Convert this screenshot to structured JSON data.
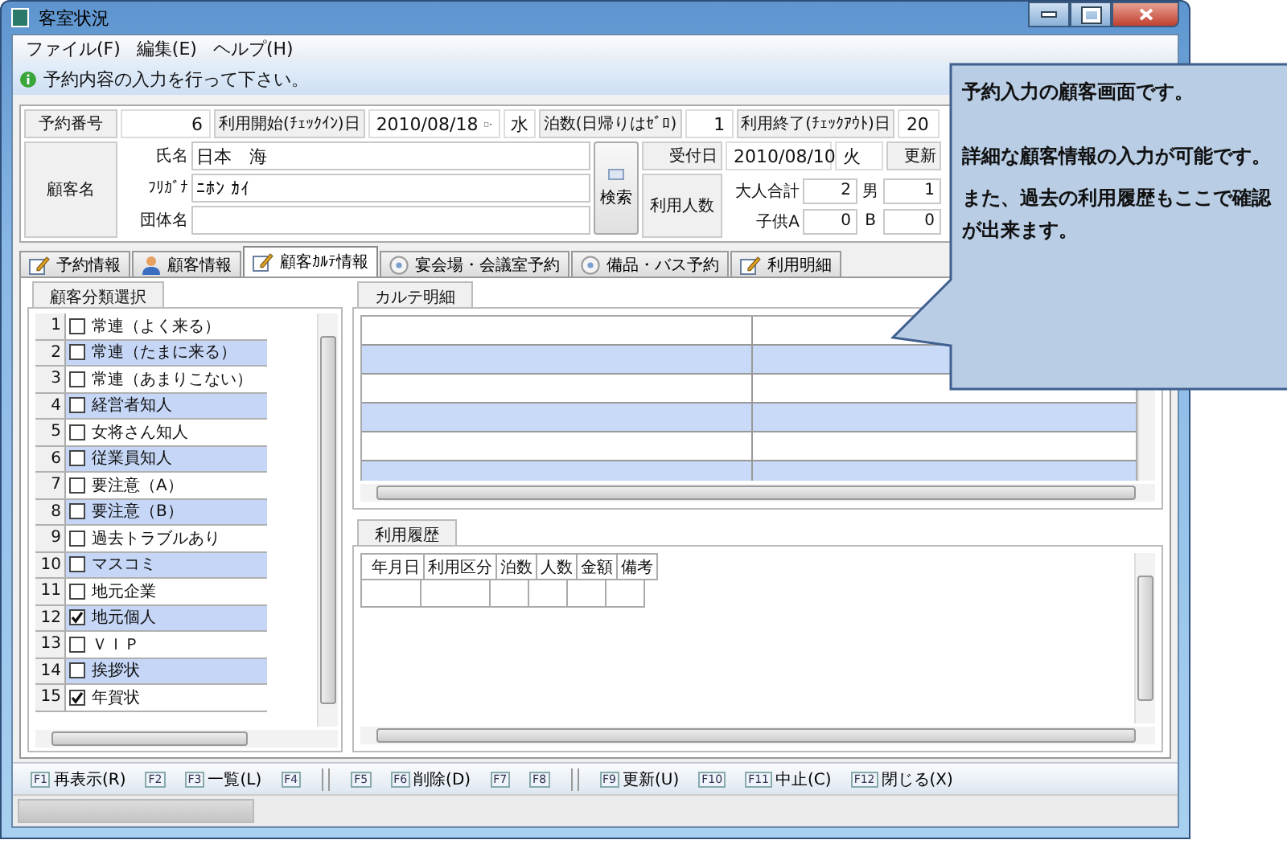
{
  "window": {
    "title": "客室状況"
  },
  "menu": [
    "ファイル(F)",
    "編集(E)",
    "ヘルプ(H)"
  ],
  "info_bar": {
    "message": "予約内容の入力を行って下さい。"
  },
  "header": {
    "reservation_no": {
      "label": "予約番号",
      "value": "6"
    },
    "checkin": {
      "label": "利用開始(ﾁｪｯｸｲﾝ)日",
      "value": "2010/08/18",
      "weekday": "水"
    },
    "nights": {
      "label": "泊数(日帰りはｾﾞﾛ)",
      "value": "1"
    },
    "checkout": {
      "label": "利用終了(ﾁｪｯｸｱｳﾄ)日",
      "value": "20"
    },
    "customer": {
      "label": "顧客名",
      "fields": [
        {
          "label": "氏名",
          "value": "日本　海"
        },
        {
          "label": "ﾌﾘｶﾞﾅ",
          "value": "ﾆﾎﾝ ｶｲ"
        },
        {
          "label": "団体名"
        }
      ],
      "search_button": "検索"
    },
    "received": {
      "label": "受付日",
      "value": "2010/08/10",
      "weekday": "火",
      "updated_label": "更新"
    },
    "guests": {
      "label": "利用人数",
      "rows": [
        {
          "label": "大人合計",
          "value": "2",
          "label2": "男",
          "value2": "1"
        },
        {
          "label": "子供A",
          "value": "0",
          "label2": "B",
          "value2": "0"
        }
      ]
    }
  },
  "tabs": [
    {
      "label": "予約情報",
      "kind": "note",
      "selected": false
    },
    {
      "label": "顧客情報",
      "kind": "person",
      "selected": false
    },
    {
      "label": "顧客ｶﾙﾃ情報",
      "kind": "note",
      "selected": true
    },
    {
      "label": "宴会場・会議室予約",
      "kind": "disc",
      "selected": false
    },
    {
      "label": "備品・バス予約",
      "kind": "disc",
      "selected": false
    },
    {
      "label": "利用明細",
      "kind": "note",
      "selected": false
    }
  ],
  "category_panel": {
    "title": "顧客分類選択",
    "items": [
      {
        "no": "1",
        "label": "常連（よく来る）",
        "checked": false
      },
      {
        "no": "2",
        "label": "常連（たまに来る）",
        "checked": false
      },
      {
        "no": "3",
        "label": "常連（あまりこない）",
        "checked": false
      },
      {
        "no": "4",
        "label": "経営者知人",
        "checked": false
      },
      {
        "no": "5",
        "label": "女将さん知人",
        "checked": false
      },
      {
        "no": "6",
        "label": "従業員知人",
        "checked": false
      },
      {
        "no": "7",
        "label": "要注意（A）",
        "checked": false
      },
      {
        "no": "8",
        "label": "要注意（B）",
        "checked": false
      },
      {
        "no": "9",
        "label": "過去トラブルあり",
        "checked": false
      },
      {
        "no": "10",
        "label": "マスコミ",
        "checked": false
      },
      {
        "no": "11",
        "label": "地元企業",
        "checked": false
      },
      {
        "no": "12",
        "label": "地元個人",
        "checked": true
      },
      {
        "no": "13",
        "label": "ＶＩＰ",
        "checked": false
      },
      {
        "no": "14",
        "label": "挨拶状",
        "checked": false
      },
      {
        "no": "15",
        "label": "年賀状",
        "checked": true
      }
    ]
  },
  "karte_panel": {
    "title": "カルテ明細"
  },
  "history_panel": {
    "title": "利用履歴",
    "columns": [
      "年月日",
      "利用区分",
      "泊数",
      "人数",
      "金額",
      "備考"
    ]
  },
  "function_keys": [
    [
      {
        "key": "F1",
        "label": "再表示(R)"
      },
      {
        "key": "F2"
      },
      {
        "key": "F3",
        "label": "一覧(L)"
      },
      {
        "key": "F4"
      }
    ],
    [
      {
        "key": "F5"
      },
      {
        "key": "F6",
        "label": "削除(D)"
      },
      {
        "key": "F7"
      },
      {
        "key": "F8"
      }
    ],
    [
      {
        "key": "F9",
        "label": "更新(U)"
      },
      {
        "key": "F10"
      },
      {
        "key": "F11",
        "label": "中止(C)"
      },
      {
        "key": "F12",
        "label": "閉じる(X)"
      }
    ]
  ],
  "callout": {
    "paragraphs": [
      "予約入力の顧客画面です。",
      "詳細な顧客情報の入力が可能です。",
      "また、過去の利用履歴もここで確認が出来ます。"
    ]
  }
}
